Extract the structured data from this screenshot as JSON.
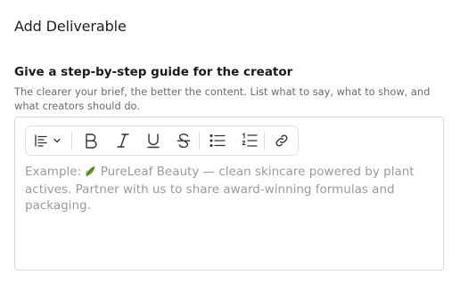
{
  "dialog": {
    "title": "Add Deliverable"
  },
  "guide": {
    "heading": "Give a step-by-step guide for the creator",
    "hint": "The clearer your brief, the better the content. List what to say, what to show, and what creators should do.",
    "placeholder_prefix": "Example: ",
    "placeholder_body": " PureLeaf Beauty — clean skincare powered by plant actives. Partner with us to share award-winning formulas and packaging."
  },
  "toolbar": {
    "buttons": [
      {
        "name": "align-left-icon"
      },
      {
        "name": "chevron-down-icon"
      },
      {
        "name": "bold-icon"
      },
      {
        "name": "italic-icon"
      },
      {
        "name": "underline-icon"
      },
      {
        "name": "strikethrough-icon"
      },
      {
        "name": "bullet-list-icon"
      },
      {
        "name": "numbered-list-icon"
      },
      {
        "name": "link-icon"
      }
    ]
  },
  "colors": {
    "placeholder": "#9a9a9a",
    "border": "#d9d9d9",
    "leaf": "#5a8a2e"
  }
}
